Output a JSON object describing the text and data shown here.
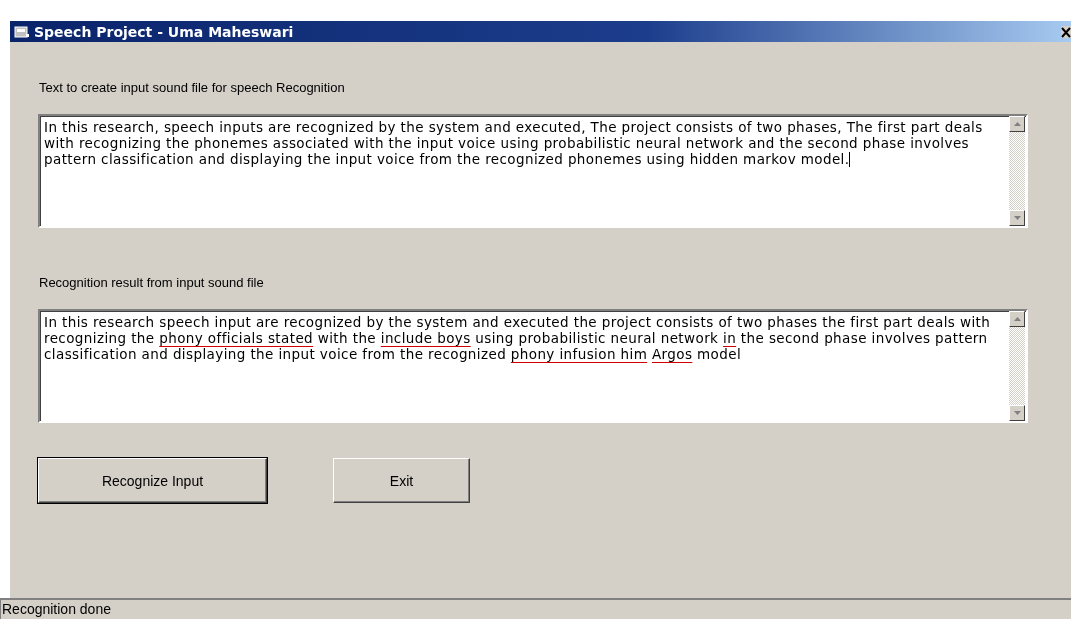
{
  "window": {
    "title": "Speech Project - Uma Maheswari"
  },
  "input_section": {
    "label": "Text to create input sound file for speech Recognition",
    "value": "In this research, speech inputs are recognized by the system and executed,  The project consists of two phases,  The first part deals with recognizing the phonemes associated with the input voice using probabilistic neural network and the second phase involves pattern classification and displaying the input voice from the recognized phonemes using hidden markov model.",
    "focused": true
  },
  "result_section": {
    "label": "Recognition result from input sound file",
    "segments": [
      {
        "text": "In this research speech input are recognized by the system and executed the project consists of two phases the first part deals with recognizing the",
        "flagged": false
      },
      {
        "text": "phony officials stated",
        "flagged": true
      },
      {
        "text": "with the",
        "flagged": false
      },
      {
        "text": "include boys",
        "flagged": true
      },
      {
        "text": "using probabilistic neural network",
        "flagged": false
      },
      {
        "text": "in",
        "flagged": true
      },
      {
        "text": "the second phase involves pattern classification and displaying the input voice from the recognized",
        "flagged": false
      },
      {
        "text": "phony infusion him",
        "flagged": true
      },
      {
        "text": "Argos",
        "flagged": true
      },
      {
        "text": "model",
        "flagged": false
      }
    ]
  },
  "buttons": [
    {
      "label": "Recognize Input",
      "default": true
    },
    {
      "label": "Exit",
      "default": false
    }
  ],
  "status_bar": {
    "text": "Recognition done"
  }
}
